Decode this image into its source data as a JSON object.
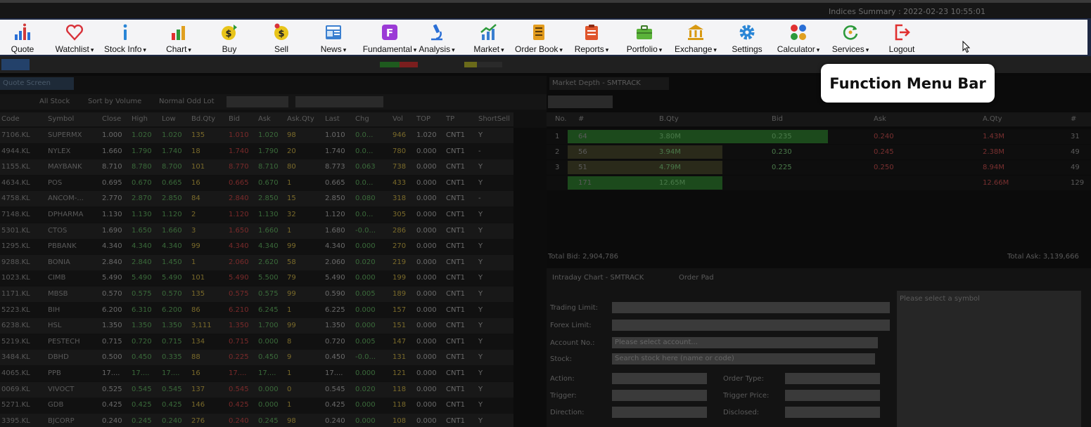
{
  "window": {
    "indices_summary": "Indices Summary : 2022-02-23 10:55:01"
  },
  "menu": {
    "items": [
      {
        "id": "quote",
        "label": "Quote",
        "icon": "bar-chart-icon",
        "dropdown": false
      },
      {
        "id": "watchlist",
        "label": "Watchlist",
        "icon": "heart-icon",
        "dropdown": true
      },
      {
        "id": "stock-info",
        "label": "Stock Info",
        "icon": "info-icon",
        "dropdown": true
      },
      {
        "id": "chart",
        "label": "Chart",
        "icon": "column-chart-icon",
        "dropdown": true
      },
      {
        "id": "buy",
        "label": "Buy",
        "icon": "buy-dollar-icon",
        "dropdown": false
      },
      {
        "id": "sell",
        "label": "Sell",
        "icon": "sell-dollar-icon",
        "dropdown": false
      },
      {
        "id": "news",
        "label": "News",
        "icon": "newspaper-icon",
        "dropdown": true
      },
      {
        "id": "fundamental",
        "label": "Fundamental",
        "icon": "fundamental-f-icon",
        "dropdown": true
      },
      {
        "id": "analysis",
        "label": "Analysis",
        "icon": "microscope-icon",
        "dropdown": true
      },
      {
        "id": "market",
        "label": "Market",
        "icon": "trend-chart-icon",
        "dropdown": true
      },
      {
        "id": "order-book",
        "label": "Order Book",
        "icon": "order-book-icon",
        "dropdown": true
      },
      {
        "id": "reports",
        "label": "Reports",
        "icon": "clipboard-icon",
        "dropdown": true
      },
      {
        "id": "portfolio",
        "label": "Portfolio",
        "icon": "briefcase-icon",
        "dropdown": true
      },
      {
        "id": "exchange",
        "label": "Exchange",
        "icon": "bank-icon",
        "dropdown": true
      },
      {
        "id": "settings",
        "label": "Settings",
        "icon": "gear-icon",
        "dropdown": false
      },
      {
        "id": "calculator",
        "label": "Calculator",
        "icon": "calculator-icon",
        "dropdown": true
      },
      {
        "id": "services",
        "label": "Services",
        "icon": "services-cycle-icon",
        "dropdown": true
      },
      {
        "id": "logout",
        "label": "Logout",
        "icon": "logout-icon",
        "dropdown": false
      }
    ]
  },
  "callout": {
    "text": "Function Menu Bar"
  },
  "quote_screen": {
    "tab": "Quote Screen",
    "filters": [
      "All Stock",
      "Sort by Volume",
      "Normal Odd Lot"
    ],
    "columns": [
      "Code",
      "Symbol",
      "Close",
      "High",
      "Low",
      "Bd.Qty",
      "Bid",
      "Ask",
      "Ask.Qty",
      "Last",
      "Chg",
      "Vol",
      "TOP",
      "TP",
      "ShortSell"
    ],
    "rows": [
      [
        "7106.KL",
        "SUPERMX",
        "1.000",
        "1.020",
        "1.020",
        "135",
        "1.010",
        "1.020",
        "98",
        "1.010",
        "0.0...",
        "946",
        "1.020",
        "CNT1",
        "Y"
      ],
      [
        "4944.KL",
        "NYLEX",
        "1.660",
        "1.790",
        "1.740",
        "18",
        "1.740",
        "1.790",
        "20",
        "1.740",
        "0.0...",
        "780",
        "0.000",
        "CNT1",
        "-"
      ],
      [
        "1155.KL",
        "MAYBANK",
        "8.710",
        "8.780",
        "8.700",
        "101",
        "8.770",
        "8.710",
        "80",
        "8.773",
        "0.063",
        "738",
        "0.000",
        "CNT1",
        "Y"
      ],
      [
        "4634.KL",
        "POS",
        "0.695",
        "0.670",
        "0.665",
        "16",
        "0.665",
        "0.670",
        "1",
        "0.665",
        "0.0...",
        "433",
        "0.000",
        "CNT1",
        "Y"
      ],
      [
        "4758.KL",
        "ANCOM-...",
        "2.770",
        "2.870",
        "2.850",
        "84",
        "2.840",
        "2.850",
        "15",
        "2.850",
        "0.080",
        "318",
        "0.000",
        "CNT1",
        "-"
      ],
      [
        "7148.KL",
        "DPHARMA",
        "1.130",
        "1.130",
        "1.120",
        "2",
        "1.120",
        "1.130",
        "32",
        "1.120",
        "0.0...",
        "305",
        "0.000",
        "CNT1",
        "Y"
      ],
      [
        "5301.KL",
        "CTOS",
        "1.690",
        "1.650",
        "1.660",
        "3",
        "1.650",
        "1.660",
        "1",
        "1.680",
        "-0.0...",
        "286",
        "0.000",
        "CNT1",
        "Y"
      ],
      [
        "1295.KL",
        "PBBANK",
        "4.340",
        "4.340",
        "4.340",
        "99",
        "4.340",
        "4.340",
        "99",
        "4.340",
        "0.000",
        "270",
        "0.000",
        "CNT1",
        "Y"
      ],
      [
        "9288.KL",
        "BONIA",
        "2.840",
        "2.840",
        "1.450",
        "1",
        "2.060",
        "2.620",
        "58",
        "2.060",
        "0.020",
        "219",
        "0.000",
        "CNT1",
        "Y"
      ],
      [
        "1023.KL",
        "CIMB",
        "5.490",
        "5.490",
        "5.490",
        "101",
        "5.490",
        "5.500",
        "79",
        "5.490",
        "0.000",
        "199",
        "0.000",
        "CNT1",
        "Y"
      ],
      [
        "1171.KL",
        "MBSB",
        "0.570",
        "0.575",
        "0.570",
        "135",
        "0.575",
        "0.575",
        "99",
        "0.590",
        "0.005",
        "189",
        "0.000",
        "CNT1",
        "Y"
      ],
      [
        "5223.KL",
        "BIH",
        "6.200",
        "6.310",
        "6.200",
        "86",
        "6.210",
        "6.245",
        "1",
        "6.225",
        "0.000",
        "157",
        "0.000",
        "CNT1",
        "Y"
      ],
      [
        "6238.KL",
        "HSL",
        "1.350",
        "1.350",
        "1.350",
        "3,111",
        "1.350",
        "1.700",
        "99",
        "1.350",
        "0.000",
        "151",
        "0.000",
        "CNT1",
        "Y"
      ],
      [
        "5219.KL",
        "PESTECH",
        "0.715",
        "0.720",
        "0.715",
        "134",
        "0.715",
        "0.000",
        "8",
        "0.720",
        "0.005",
        "147",
        "0.000",
        "CNT1",
        "Y"
      ],
      [
        "3484.KL",
        "DBHD",
        "0.500",
        "0.450",
        "0.335",
        "88",
        "0.225",
        "0.450",
        "9",
        "0.450",
        "-0.0...",
        "131",
        "0.000",
        "CNT1",
        "Y"
      ],
      [
        "4065.KL",
        "PPB",
        "17....",
        "17....",
        "17....",
        "16",
        "17....",
        "17....",
        "1",
        "17....",
        "0.000",
        "121",
        "0.000",
        "CNT1",
        "Y"
      ],
      [
        "0069.KL",
        "VIVOCT",
        "0.525",
        "0.545",
        "0.545",
        "137",
        "0.545",
        "0.000",
        "0",
        "0.545",
        "0.020",
        "118",
        "0.000",
        "CNT1",
        "Y"
      ],
      [
        "5271.KL",
        "GDB",
        "0.425",
        "0.425",
        "0.425",
        "146",
        "0.425",
        "0.000",
        "1",
        "0.425",
        "0.000",
        "118",
        "0.000",
        "CNT1",
        "Y"
      ],
      [
        "3395.KL",
        "BJCORP",
        "0.240",
        "0.245",
        "0.240",
        "276",
        "0.240",
        "0.245",
        "98",
        "0.240",
        "0.000",
        "108",
        "0.000",
        "CNT1",
        "Y"
      ]
    ]
  },
  "market_depth": {
    "tab": "Market Depth - SMTRACK",
    "columns": [
      "No.",
      "#",
      "B.Qty",
      "Bid",
      "Ask",
      "A.Qty",
      "#"
    ],
    "rows": [
      [
        "1",
        "64",
        "3.80M",
        "0.235",
        "0.240",
        "1.43M",
        "31"
      ],
      [
        "2",
        "56",
        "3.94M",
        "0.230",
        "0.245",
        "2.38M",
        "49"
      ],
      [
        "3",
        "51",
        "4.79M",
        "0.225",
        "0.250",
        "8.94M",
        "49"
      ],
      [
        "",
        "171",
        "12.65M",
        "",
        "",
        "12.66M",
        "129"
      ]
    ],
    "total_bid": "Total Bid: 2,904,786",
    "total_ask": "Total Ask: 3,139,666"
  },
  "order_pad": {
    "tabs": [
      "Intraday Chart - SMTRACK",
      "Order Pad"
    ],
    "labels": [
      "Trading Limit:",
      "Forex Limit:",
      "Account No.:",
      "Stock:",
      "Action:",
      "Trigger:",
      "Direction:"
    ],
    "right_labels": [
      "Order Type:",
      "Trigger Price:",
      "Disclosed:"
    ],
    "account_placeholder": "Please select account...",
    "stock_placeholder": "Search stock here (name or code)",
    "symbol_placeholder": "Please select a symbol"
  },
  "colors": {
    "menu_bg": "#f4f4f6",
    "menu_border": "#1d2742",
    "accent_green": "#1e7a1e",
    "accent_red": "#8a1f1f"
  }
}
